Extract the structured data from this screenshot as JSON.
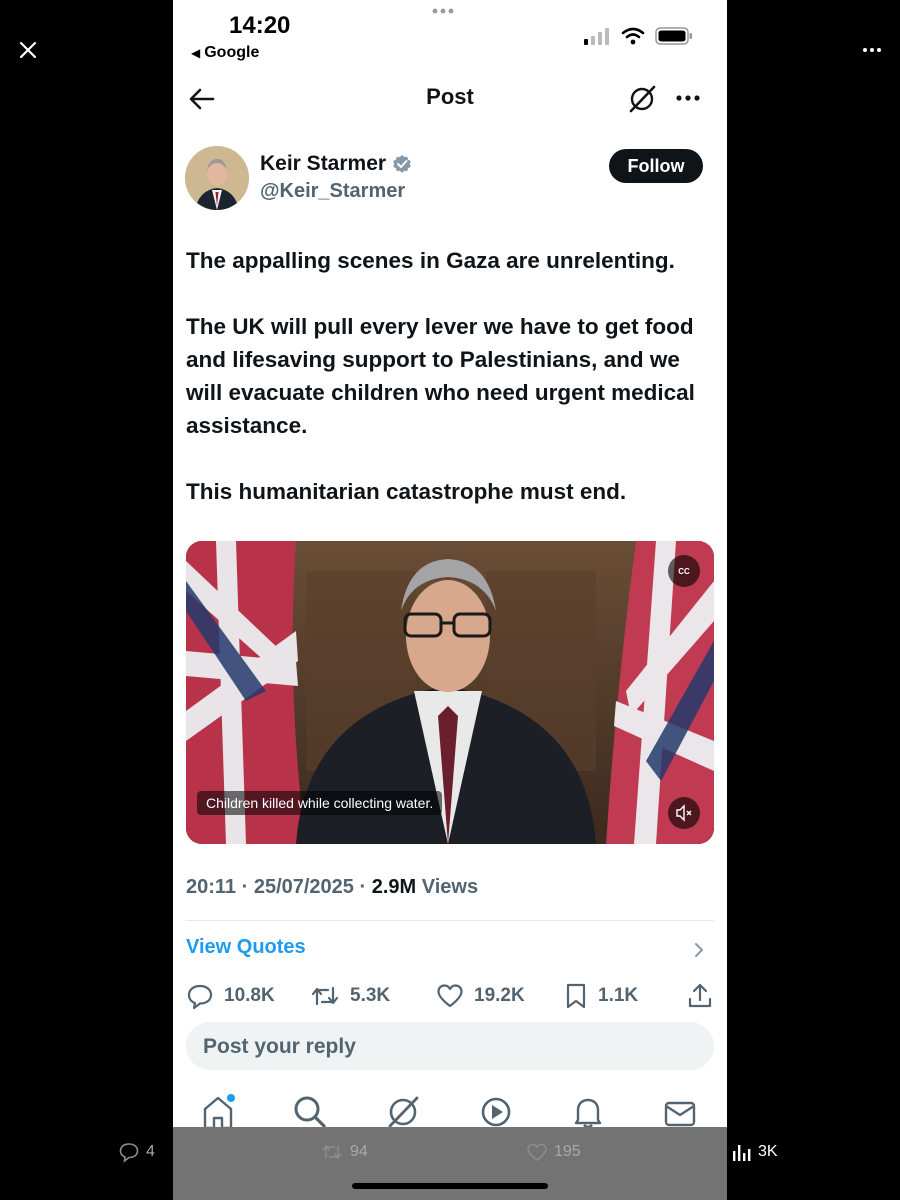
{
  "viewer": {
    "close_icon": "close-icon",
    "more_icon": "more-horizontal-icon"
  },
  "status_bar": {
    "time": "14:20",
    "back_app": "Google"
  },
  "nav": {
    "title": "Post"
  },
  "author": {
    "name": "Keir Starmer",
    "handle": "@Keir_Starmer",
    "verified": true,
    "follow_label": "Follow"
  },
  "post": {
    "paragraphs": [
      "The appalling scenes in Gaza are unrelenting.",
      "The UK will pull every lever we have to get food and lifesaving support to Palestinians, and we will evacuate children who need urgent medical assistance.",
      "This humanitarian catastrophe must end."
    ],
    "video_caption": "Children killed while collecting water.",
    "cc_label": "CC",
    "timestamp": "20:11 · 25/07/2025 · ",
    "views_count": "2.9M",
    "views_label": " Views"
  },
  "view_quotes_label": "View Quotes",
  "actions": {
    "replies": "10.8K",
    "reposts": "5.3K",
    "likes": "19.2K",
    "bookmarks": "1.1K"
  },
  "reply_placeholder": "Post your reply",
  "tab_bar": [
    "home-icon",
    "search-icon",
    "grok-icon",
    "video-icon",
    "notifications-icon",
    "messages-icon"
  ],
  "overlay_stats": {
    "comments": "4",
    "reposts": "94",
    "likes": "195",
    "views": "3K"
  },
  "colors": {
    "accent": "#1d9bf0",
    "text": "#0f1419",
    "secondary": "#536471"
  }
}
